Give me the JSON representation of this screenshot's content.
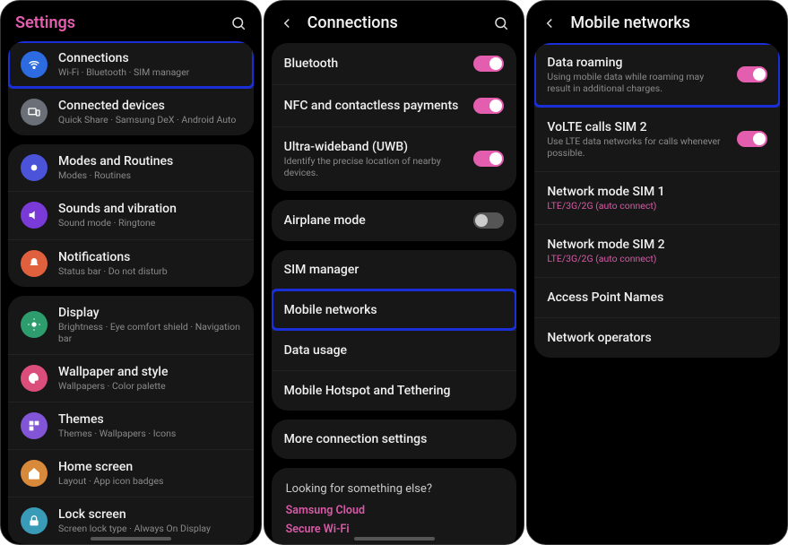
{
  "colors": {
    "accent": "#e45eb0",
    "highlight": "#1a2fd8",
    "card": "#171717"
  },
  "screen1": {
    "title": "Settings",
    "groups": [
      [
        {
          "icon": "wifi",
          "chip": "#2d6be0",
          "label": "Connections",
          "sub": "Wi-Fi · Bluetooth · SIM manager",
          "highlight": true
        },
        {
          "icon": "devices",
          "chip": "#6a6f78",
          "label": "Connected devices",
          "sub": "Quick Share · Samsung DeX · Android Auto"
        }
      ],
      [
        {
          "icon": "routines",
          "chip": "#4b53d8",
          "label": "Modes and Routines",
          "sub": "Modes · Routines"
        },
        {
          "icon": "sound",
          "chip": "#7a3ad8",
          "label": "Sounds and vibration",
          "sub": "Sound mode · Ringtone"
        },
        {
          "icon": "bell",
          "chip": "#e0603e",
          "label": "Notifications",
          "sub": "Status bar · Do not disturb"
        }
      ],
      [
        {
          "icon": "display",
          "chip": "#2e9d6e",
          "label": "Display",
          "sub": "Brightness · Eye comfort shield · Navigation bar"
        },
        {
          "icon": "palette",
          "chip": "#db4d7b",
          "label": "Wallpaper and style",
          "sub": "Wallpapers · Color palette"
        },
        {
          "icon": "themes",
          "chip": "#8255d6",
          "label": "Themes",
          "sub": "Themes · Wallpapers · Icons"
        },
        {
          "icon": "home",
          "chip": "#d88a3a",
          "label": "Home screen",
          "sub": "Layout · App icon badges"
        },
        {
          "icon": "lock",
          "chip": "#3a9bb8",
          "label": "Lock screen",
          "sub": "Screen lock type · Always On Display"
        }
      ]
    ]
  },
  "screen2": {
    "title": "Connections",
    "groups": [
      [
        {
          "label": "Bluetooth",
          "toggle": "on"
        },
        {
          "label": "NFC and contactless payments",
          "toggle": "on"
        },
        {
          "label": "Ultra-wideband (UWB)",
          "sub": "Identify the precise location of nearby devices.",
          "toggle": "on"
        }
      ],
      [
        {
          "label": "Airplane mode",
          "toggle": "off"
        }
      ],
      [
        {
          "label": "SIM manager"
        },
        {
          "label": "Mobile networks",
          "highlight": true
        },
        {
          "label": "Data usage"
        },
        {
          "label": "Mobile Hotspot and Tethering"
        }
      ],
      [
        {
          "label": "More connection settings"
        }
      ]
    ],
    "suggest": {
      "heading": "Looking for something else?",
      "links": [
        "Samsung Cloud",
        "Secure Wi-Fi"
      ]
    }
  },
  "screen3": {
    "title": "Mobile networks",
    "rows": [
      {
        "label": "Data roaming",
        "sub": "Using mobile data while roaming may result in additional charges.",
        "toggle": "on",
        "highlight": true
      },
      {
        "label": "VoLTE calls SIM 2",
        "sub": "Use LTE data networks for calls whenever possible.",
        "toggle": "on"
      },
      {
        "label": "Network mode SIM 1",
        "sub": "LTE/3G/2G (auto connect)",
        "subPink": true
      },
      {
        "label": "Network mode SIM 2",
        "sub": "LTE/3G/2G (auto connect)",
        "subPink": true
      },
      {
        "label": "Access Point Names"
      },
      {
        "label": "Network operators"
      }
    ]
  }
}
